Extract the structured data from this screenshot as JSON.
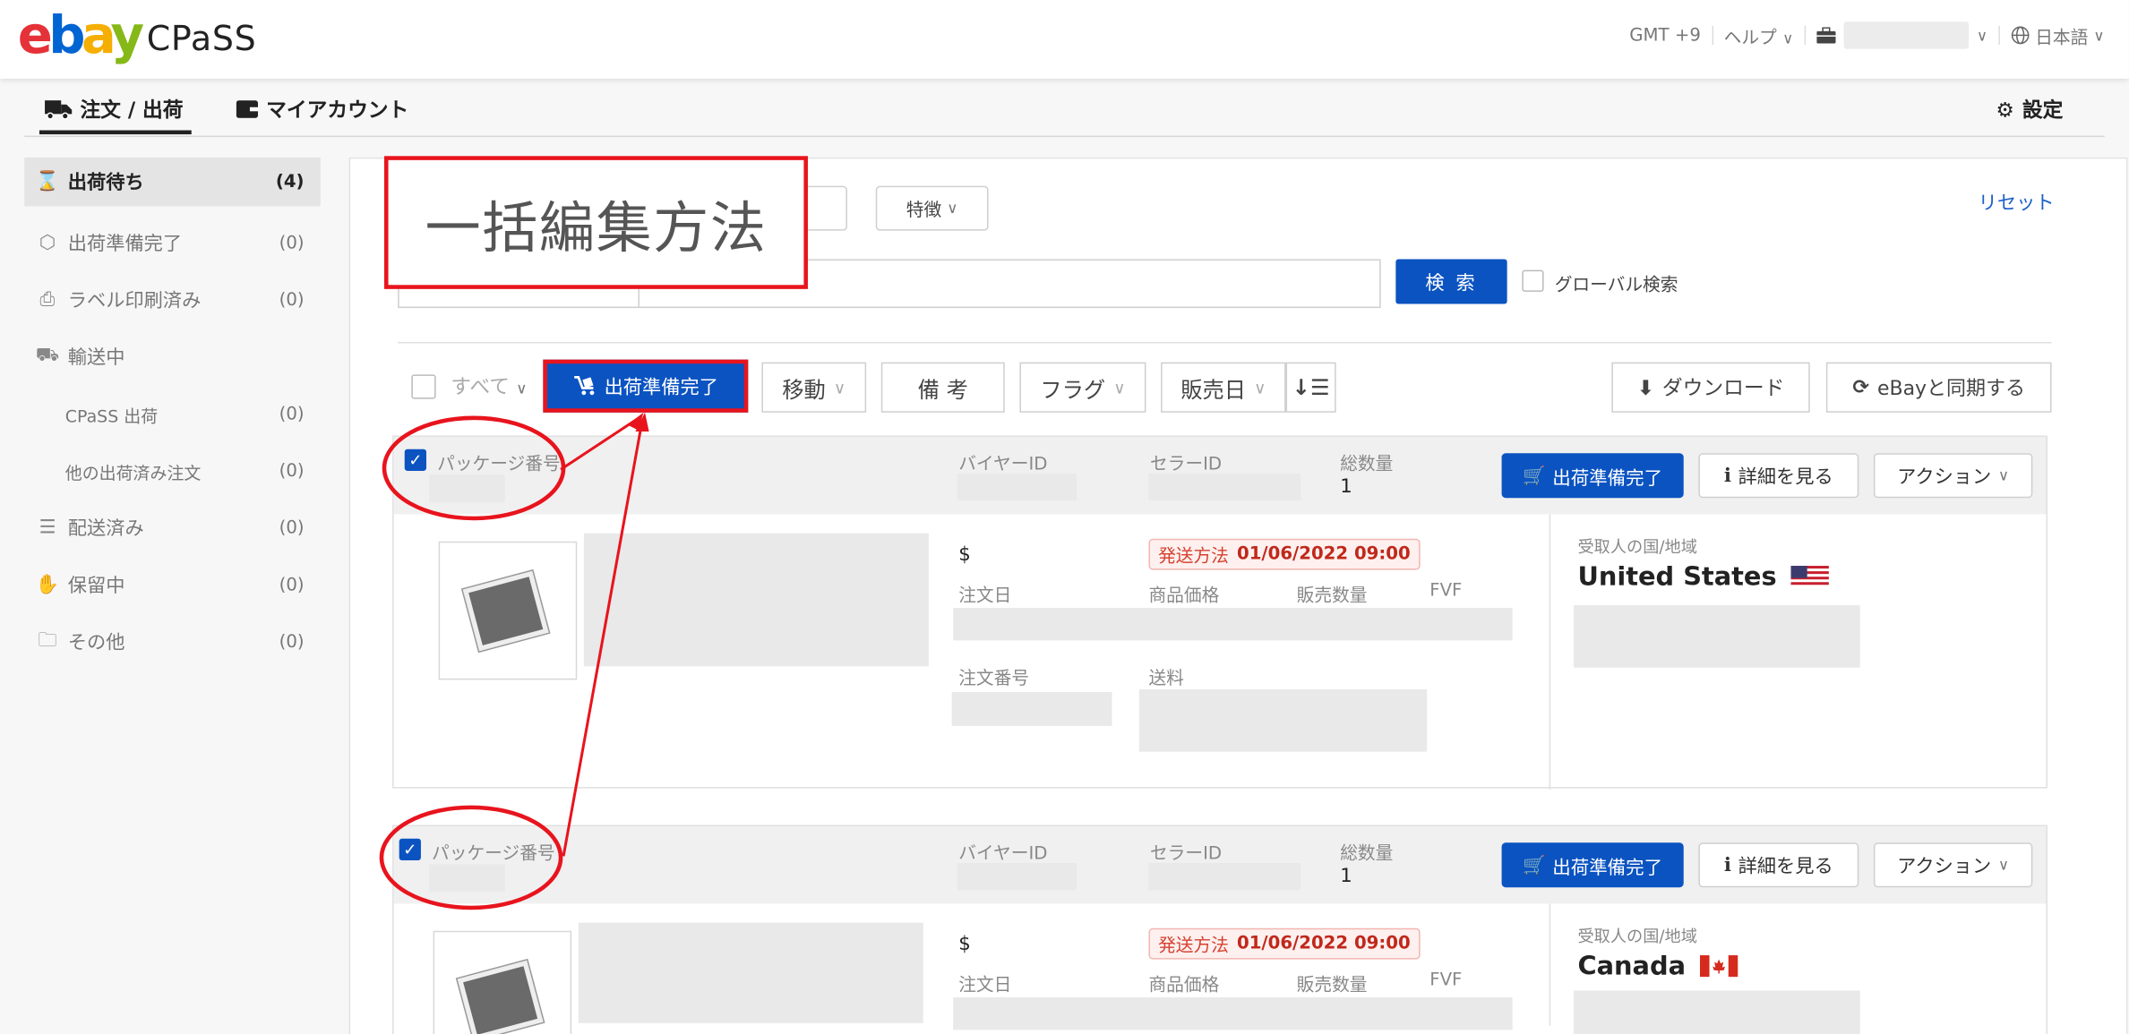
{
  "header": {
    "logo_letters": [
      "e",
      "b",
      "a",
      "y"
    ],
    "product": "CPaSS",
    "timezone": "GMT +9",
    "help": "ヘルプ",
    "language": "日本語"
  },
  "nav": {
    "orders": "注文 / 出荷",
    "account": "マイアカウント",
    "settings": "設定"
  },
  "sidebar": {
    "items": [
      {
        "label": "出荷待ち",
        "count": "(4)"
      },
      {
        "label": "出荷準備完了",
        "count": "(0)"
      },
      {
        "label": "ラベル印刷済み",
        "count": "(0)"
      },
      {
        "label": "輸送中",
        "count": ""
      },
      {
        "label": "CPaSS 出荷",
        "count": "(0)"
      },
      {
        "label": "他の出荷済み注文",
        "count": "(0)"
      },
      {
        "label": "配送済み",
        "count": "(0)"
      },
      {
        "label": "保留中",
        "count": "(0)"
      },
      {
        "label": "その他",
        "count": "(0)"
      }
    ]
  },
  "filters": {
    "reset": "リセット",
    "feature": "特徴",
    "search_button": "検 索",
    "global_search": "グローバル検索"
  },
  "toolbar": {
    "select_all": "すべて",
    "ready": "出荷準備完了",
    "move": "移動",
    "note": "備 考",
    "flag": "フラグ",
    "sale_date": "販売日",
    "download": "ダウンロード",
    "sync": "eBayと同期する"
  },
  "annotation": {
    "callout": "一括編集方法"
  },
  "packages": [
    {
      "package_label": "パッケージ番号",
      "buyer_label": "バイヤーID",
      "seller_label": "セラーID",
      "qty_label": "総数量",
      "qty": "1",
      "ready_button": "出荷準備完了",
      "detail_button": "詳細を見る",
      "action_button": "アクション",
      "currency": "$",
      "ship_label": "発送方法",
      "ship_date": "01/06/2022 09:00",
      "order_date": "注文日",
      "price": "商品価格",
      "sold_qty": "販売数量",
      "fvf": "FVF",
      "order_no": "注文番号",
      "shipping": "送料",
      "country_label": "受取人の国/地域",
      "country": "United States",
      "flag": "us-flag"
    },
    {
      "package_label": "パッケージ番号",
      "buyer_label": "バイヤーID",
      "seller_label": "セラーID",
      "qty_label": "総数量",
      "qty": "1",
      "ready_button": "出荷準備完了",
      "detail_button": "詳細を見る",
      "action_button": "アクション",
      "currency": "$",
      "ship_label": "発送方法",
      "ship_date": "01/06/2022 09:00",
      "order_date": "注文日",
      "price": "商品価格",
      "sold_qty": "販売数量",
      "fvf": "FVF",
      "country_label": "受取人の国/地域",
      "country": "Canada",
      "flag": "canada-flag"
    }
  ],
  "colors": {
    "primary": "#0b53c1",
    "annotation": "#e8141d"
  }
}
